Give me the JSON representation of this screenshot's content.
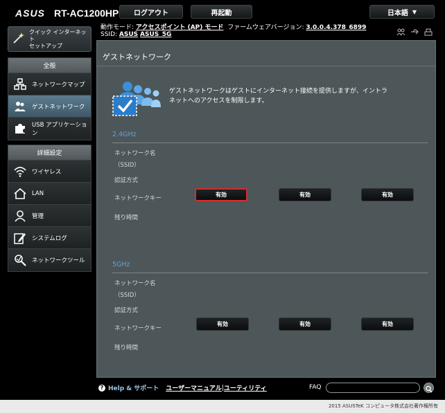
{
  "header": {
    "logo": "/ISUS",
    "model": "RT-AC1200HP",
    "logout_label": "ログアウト",
    "reboot_label": "再起動",
    "language": "日本語"
  },
  "status": {
    "mode_label": "動作モード:",
    "mode_value": "アクセスポイント (AP) モード",
    "firmware_label": "ファームウェアバージョン:",
    "firmware_value": "3.0.0.4.378_6899",
    "ssid_label": "SSID:",
    "ssid_1": "ASUS",
    "ssid_2": "ASUS_5G"
  },
  "sidebar": {
    "qis_line1": "クイック インターネット",
    "qis_line2": "セットアップ",
    "general_header": "全般",
    "general_items": [
      {
        "label": "ネットワークマップ"
      },
      {
        "label": "ゲストネットワーク"
      },
      {
        "label": "USB アプリケーション"
      }
    ],
    "advanced_header": "詳細設定",
    "advanced_items": [
      {
        "label": "ワイヤレス"
      },
      {
        "label": "LAN"
      },
      {
        "label": "管理"
      },
      {
        "label": "システムログ"
      },
      {
        "label": "ネットワークツール"
      }
    ]
  },
  "main": {
    "title": "ゲストネットワーク",
    "description_line1": "ゲストネットワークはゲストにインターネット接続を提供しますが、イントラ",
    "description_line2": "ネットへのアクセスを制限します。",
    "band_24": "2.4GHz",
    "band_5": "5GHz",
    "field_network_name": "ネットワーク名",
    "field_ssid": "（SSID）",
    "field_auth": "認証方式",
    "field_key": "ネットワークキー",
    "field_time": "残り時間",
    "enable_label": "有効"
  },
  "footer": {
    "help": "Help & サポート",
    "manual": "ユーザーマニュアル",
    "separator": "|",
    "utility": "ユーティリティ",
    "faq": "FAQ",
    "copyright": "2015 ASUSTeK コンピュータ株式会社著作権所有"
  },
  "colors": {
    "accent_blue": "#60a2d4",
    "panel_bg": "#4d5659",
    "active_nav": "#4f6d7e",
    "focus_border": "#d72b2b"
  }
}
